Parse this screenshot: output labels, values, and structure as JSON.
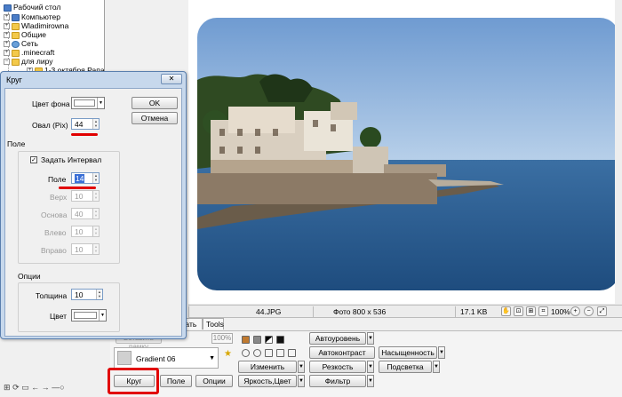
{
  "tree": {
    "items": [
      {
        "label": "Рабочий стол",
        "icon": "desktop-icon"
      },
      {
        "label": "Компьютер",
        "icon": "computer-icon"
      },
      {
        "label": "Wladimirowna",
        "icon": "user-folder-icon"
      },
      {
        "label": "Общие",
        "icon": "folder-icon"
      },
      {
        "label": "Сеть",
        "icon": "network-icon"
      },
      {
        "label": ".minecraft",
        "icon": "folder-icon"
      },
      {
        "label": "для лиру",
        "icon": "folder-icon"
      },
      {
        "label": "1-3 октября Рапа",
        "icon": "folder-icon"
      }
    ]
  },
  "dialog": {
    "title": "Круг",
    "close": "✕",
    "bg_color_label": "Цвет фона",
    "oval_label": "Овал (Pix)",
    "oval_value": "44",
    "ok": "OK",
    "cancel": "Отмена",
    "field_group": "Поле",
    "set_interval": "Задать Интервал",
    "field_label": "Поле",
    "field_value": "14",
    "top_label": "Верх",
    "top_value": "10",
    "bottom_label": "Основа",
    "bottom_value": "40",
    "left_label": "Влево",
    "left_value": "10",
    "right_label": "Вправо",
    "right_value": "10",
    "options_group": "Опции",
    "thickness_label": "Толщина",
    "thickness_value": "10",
    "color_label": "Цвет"
  },
  "status": {
    "filename": "44.JPG",
    "dims": "Фото 800 x 536",
    "size": "17.1 KB",
    "zoom": "100%"
  },
  "bottom": {
    "tab_partial": "вать",
    "tab_tools": "Tools",
    "percent": "100%",
    "ghost_btn": "Вставить рамку",
    "gradient": "Gradient 06",
    "buttons": {
      "auto_level": "Автоуровень",
      "saturation": "Насыщенность",
      "auto_contrast": "Автоконтраст",
      "change": "Изменить",
      "sharpness": "Резкость",
      "highlight": "Подсветка",
      "circle": "Круг",
      "field": "Поле",
      "options": "Опции",
      "brightness": "Яркость,Цвет",
      "filter": "Фильтр"
    }
  },
  "colors": {
    "accent_red": "#e10000",
    "dialog_frame": "#c7d8ec",
    "selection": "#3a6fd6"
  }
}
